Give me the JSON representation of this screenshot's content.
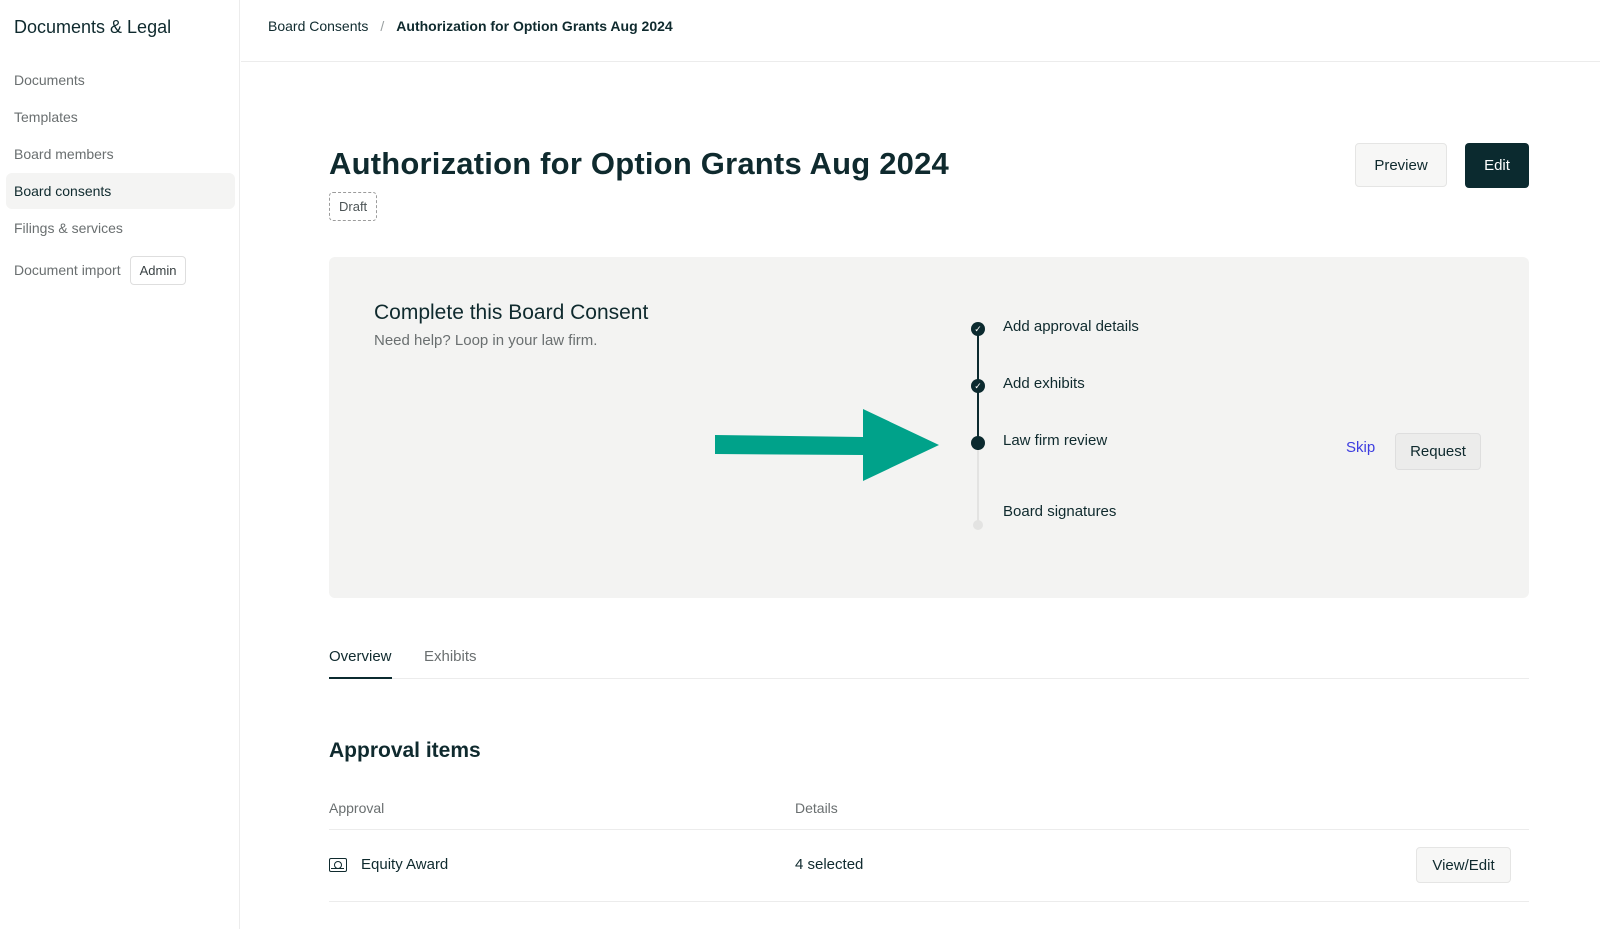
{
  "sidebar": {
    "title": "Documents & Legal",
    "items": [
      {
        "label": "Documents"
      },
      {
        "label": "Templates"
      },
      {
        "label": "Board members"
      },
      {
        "label": "Board consents"
      },
      {
        "label": "Filings & services"
      },
      {
        "label": "Document import",
        "badge": "Admin"
      }
    ]
  },
  "breadcrumb": {
    "parent": "Board Consents",
    "separator": "/",
    "current": "Authorization for Option Grants Aug 2024"
  },
  "header": {
    "title": "Authorization for Option Grants Aug 2024",
    "status": "Draft",
    "preview_label": "Preview",
    "edit_label": "Edit"
  },
  "consent_panel": {
    "title": "Complete this Board Consent",
    "subtitle": "Need help? Loop in your law firm.",
    "steps": [
      {
        "label": "Add approval details",
        "state": "complete"
      },
      {
        "label": "Add exhibits",
        "state": "complete"
      },
      {
        "label": "Law firm review",
        "state": "current",
        "skip_label": "Skip",
        "action_label": "Request"
      },
      {
        "label": "Board signatures",
        "state": "pending"
      }
    ],
    "arrow_color": "#00a28a"
  },
  "tabs": [
    {
      "label": "Overview",
      "active": true
    },
    {
      "label": "Exhibits",
      "active": false
    }
  ],
  "approvals": {
    "title": "Approval items",
    "columns": [
      "Approval",
      "Details"
    ],
    "rows": [
      {
        "name": "Equity Award",
        "details": "4 selected",
        "action_label": "View/Edit"
      }
    ]
  },
  "colors": {
    "primary": "#0b2a2f",
    "link": "#3d3de0",
    "panel_bg": "#f3f3f2"
  }
}
